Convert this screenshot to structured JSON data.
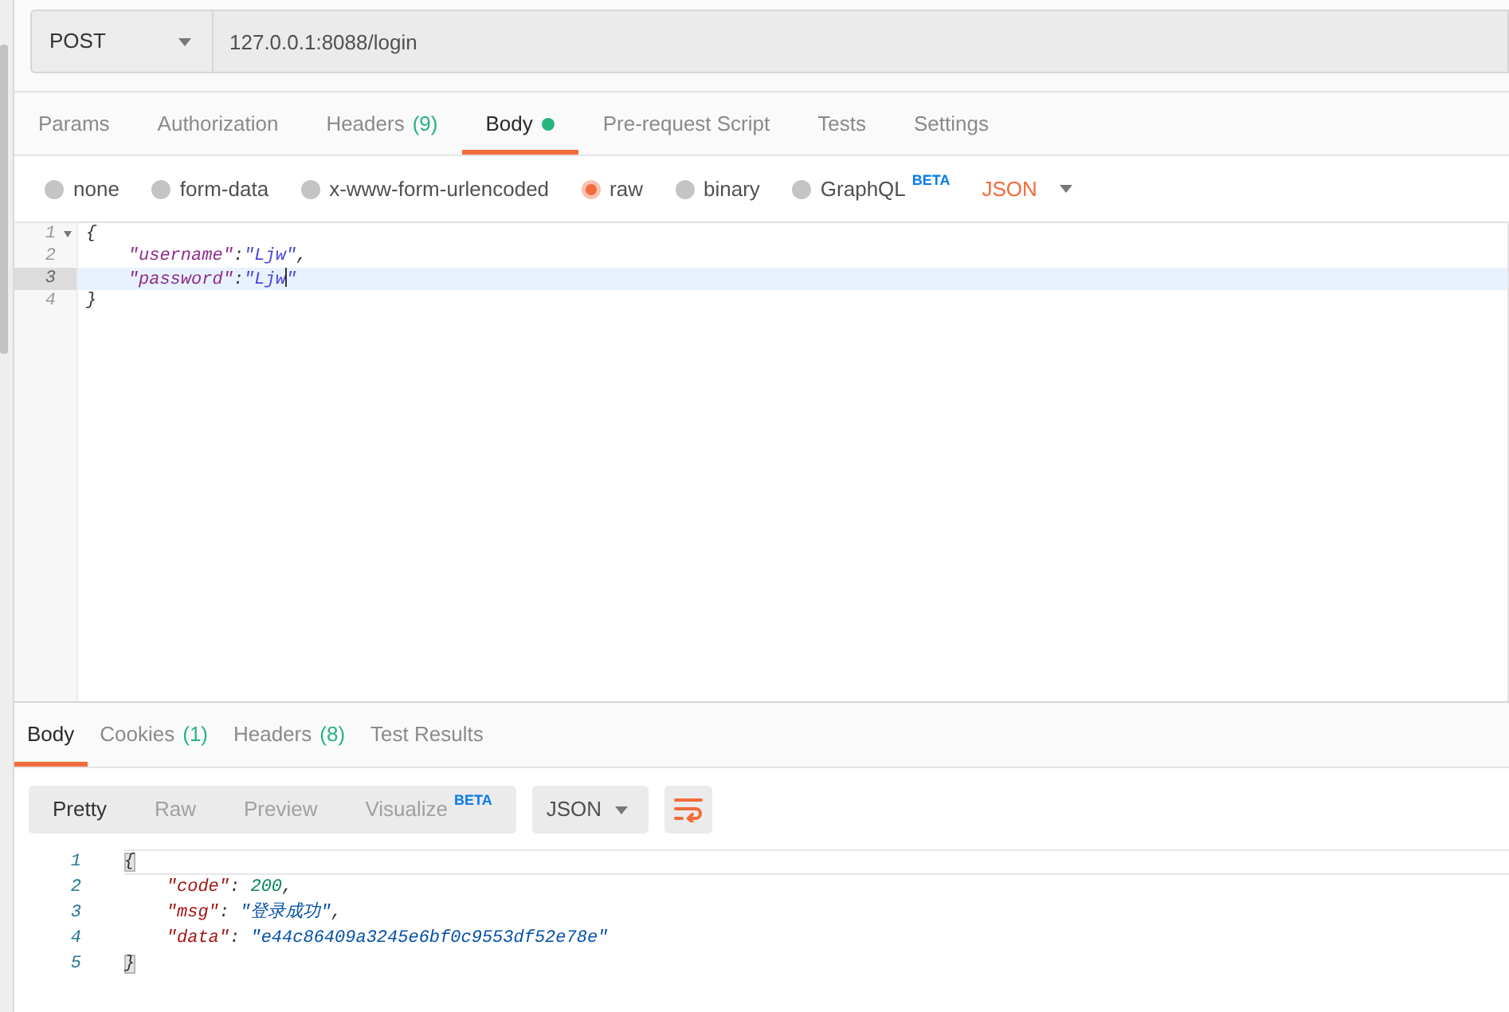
{
  "request": {
    "method": "POST",
    "url": "127.0.0.1:8088/login"
  },
  "request_tabs": [
    {
      "label": "Params",
      "selected": false
    },
    {
      "label": "Authorization",
      "selected": false
    },
    {
      "label": "Headers",
      "count": "(9)",
      "selected": false
    },
    {
      "label": "Body",
      "selected": true,
      "has_content": true
    },
    {
      "label": "Pre-request Script",
      "selected": false
    },
    {
      "label": "Tests",
      "selected": false
    },
    {
      "label": "Settings",
      "selected": false
    }
  ],
  "body_types": [
    {
      "label": "none",
      "selected": false
    },
    {
      "label": "form-data",
      "selected": false
    },
    {
      "label": "x-www-form-urlencoded",
      "selected": false
    },
    {
      "label": "raw",
      "selected": true
    },
    {
      "label": "binary",
      "selected": false
    },
    {
      "label": "GraphQL",
      "badge": "BETA",
      "selected": false
    }
  ],
  "body_format": {
    "label": "JSON"
  },
  "request_body": {
    "lines": [
      {
        "number": "1",
        "foldable": true,
        "active": false,
        "tokens": [
          {
            "kind": "punct",
            "text": "{"
          }
        ]
      },
      {
        "number": "2",
        "foldable": false,
        "active": false,
        "tokens": [
          {
            "kind": "key",
            "text": "    \"username\""
          },
          {
            "kind": "punct",
            "text": ":"
          },
          {
            "kind": "string",
            "text": "\"Ljw\""
          },
          {
            "kind": "punct",
            "text": ","
          }
        ]
      },
      {
        "number": "3",
        "foldable": false,
        "active": true,
        "tokens": [
          {
            "kind": "key",
            "text": "    \"password\""
          },
          {
            "kind": "punct",
            "text": ":"
          },
          {
            "kind": "string",
            "text": "\"Ljw"
          },
          {
            "kind": "cursor"
          },
          {
            "kind": "string",
            "text": "\""
          }
        ]
      },
      {
        "number": "4",
        "foldable": false,
        "active": false,
        "tokens": [
          {
            "kind": "punct",
            "text": "}"
          }
        ]
      }
    ]
  },
  "response_tabs": [
    {
      "label": "Body",
      "selected": true
    },
    {
      "label": "Cookies",
      "count": "(1)",
      "selected": false
    },
    {
      "label": "Headers",
      "count": "(8)",
      "selected": false
    },
    {
      "label": "Test Results",
      "selected": false
    }
  ],
  "view_modes": [
    {
      "label": "Pretty",
      "selected": true
    },
    {
      "label": "Raw",
      "selected": false
    },
    {
      "label": "Preview",
      "selected": false
    },
    {
      "label": "Visualize",
      "badge": "BETA",
      "selected": false
    }
  ],
  "response_format": {
    "label": "JSON"
  },
  "response_body": {
    "lines": [
      {
        "number": "1",
        "active": true,
        "tokens": [
          {
            "kind": "punct",
            "text": "{",
            "highlighted": true
          }
        ]
      },
      {
        "number": "2",
        "active": false,
        "tokens": [
          {
            "kind": "key",
            "text": "    \"code\"",
            "highlighted": false
          },
          {
            "kind": "punct",
            "text": ": ",
            "highlighted": false
          },
          {
            "kind": "number",
            "text": "200",
            "highlighted": false
          },
          {
            "kind": "punct",
            "text": ",",
            "highlighted": false
          }
        ]
      },
      {
        "number": "3",
        "active": false,
        "tokens": [
          {
            "kind": "key",
            "text": "    \"msg\"",
            "highlighted": false
          },
          {
            "kind": "punct",
            "text": ": ",
            "highlighted": false
          },
          {
            "kind": "string",
            "text": "\"登录成功\"",
            "highlighted": false
          },
          {
            "kind": "punct",
            "text": ",",
            "highlighted": false
          }
        ]
      },
      {
        "number": "4",
        "active": false,
        "tokens": [
          {
            "kind": "key",
            "text": "    \"data\"",
            "highlighted": false
          },
          {
            "kind": "punct",
            "text": ": ",
            "highlighted": false
          },
          {
            "kind": "string",
            "text": "\"e44c86409a3245e6bf0c9553df52e78e\"",
            "highlighted": false
          }
        ]
      },
      {
        "number": "5",
        "active": false,
        "tokens": [
          {
            "kind": "punct",
            "text": "}",
            "highlighted": true
          }
        ]
      }
    ]
  }
}
